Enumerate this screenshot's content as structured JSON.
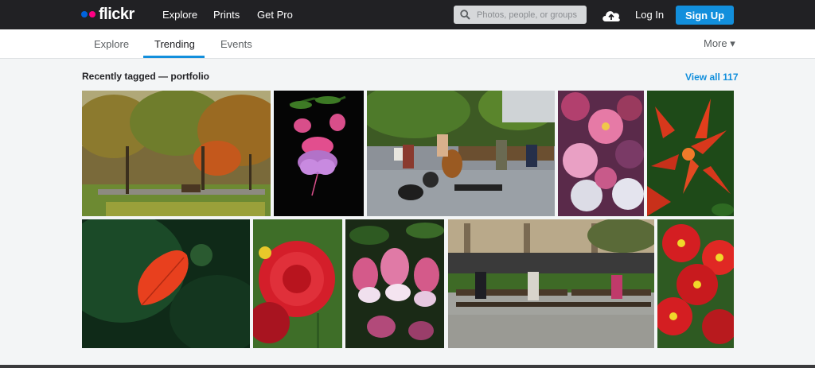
{
  "header": {
    "logo_text": "flickr",
    "logo_colors": {
      "blue": "#0063dc",
      "pink": "#ff0084"
    },
    "nav": [
      "Explore",
      "Prints",
      "Get Pro"
    ],
    "search_placeholder": "Photos, people, or groups",
    "upload_icon": "cloud-upload-icon",
    "login_label": "Log In",
    "signup_label": "Sign Up",
    "accent": "#128fdc"
  },
  "subnav": {
    "tabs": [
      "Explore",
      "Trending",
      "Events"
    ],
    "active_tab": "Trending",
    "more_label": "More ▾"
  },
  "section": {
    "title": "Recently tagged — portfolio",
    "view_all_label": "View all 117"
  },
  "photos": [
    {
      "subject": "autumn park"
    },
    {
      "subject": "fuchsia flower on black"
    },
    {
      "subject": "street musicians"
    },
    {
      "subject": "pink flowers"
    },
    {
      "subject": "red lilies"
    },
    {
      "subject": "red leaf"
    },
    {
      "subject": "red dahlia"
    },
    {
      "subject": "fuchsia flowers"
    },
    {
      "subject": "people on park benches"
    },
    {
      "subject": "red daisies"
    }
  ]
}
